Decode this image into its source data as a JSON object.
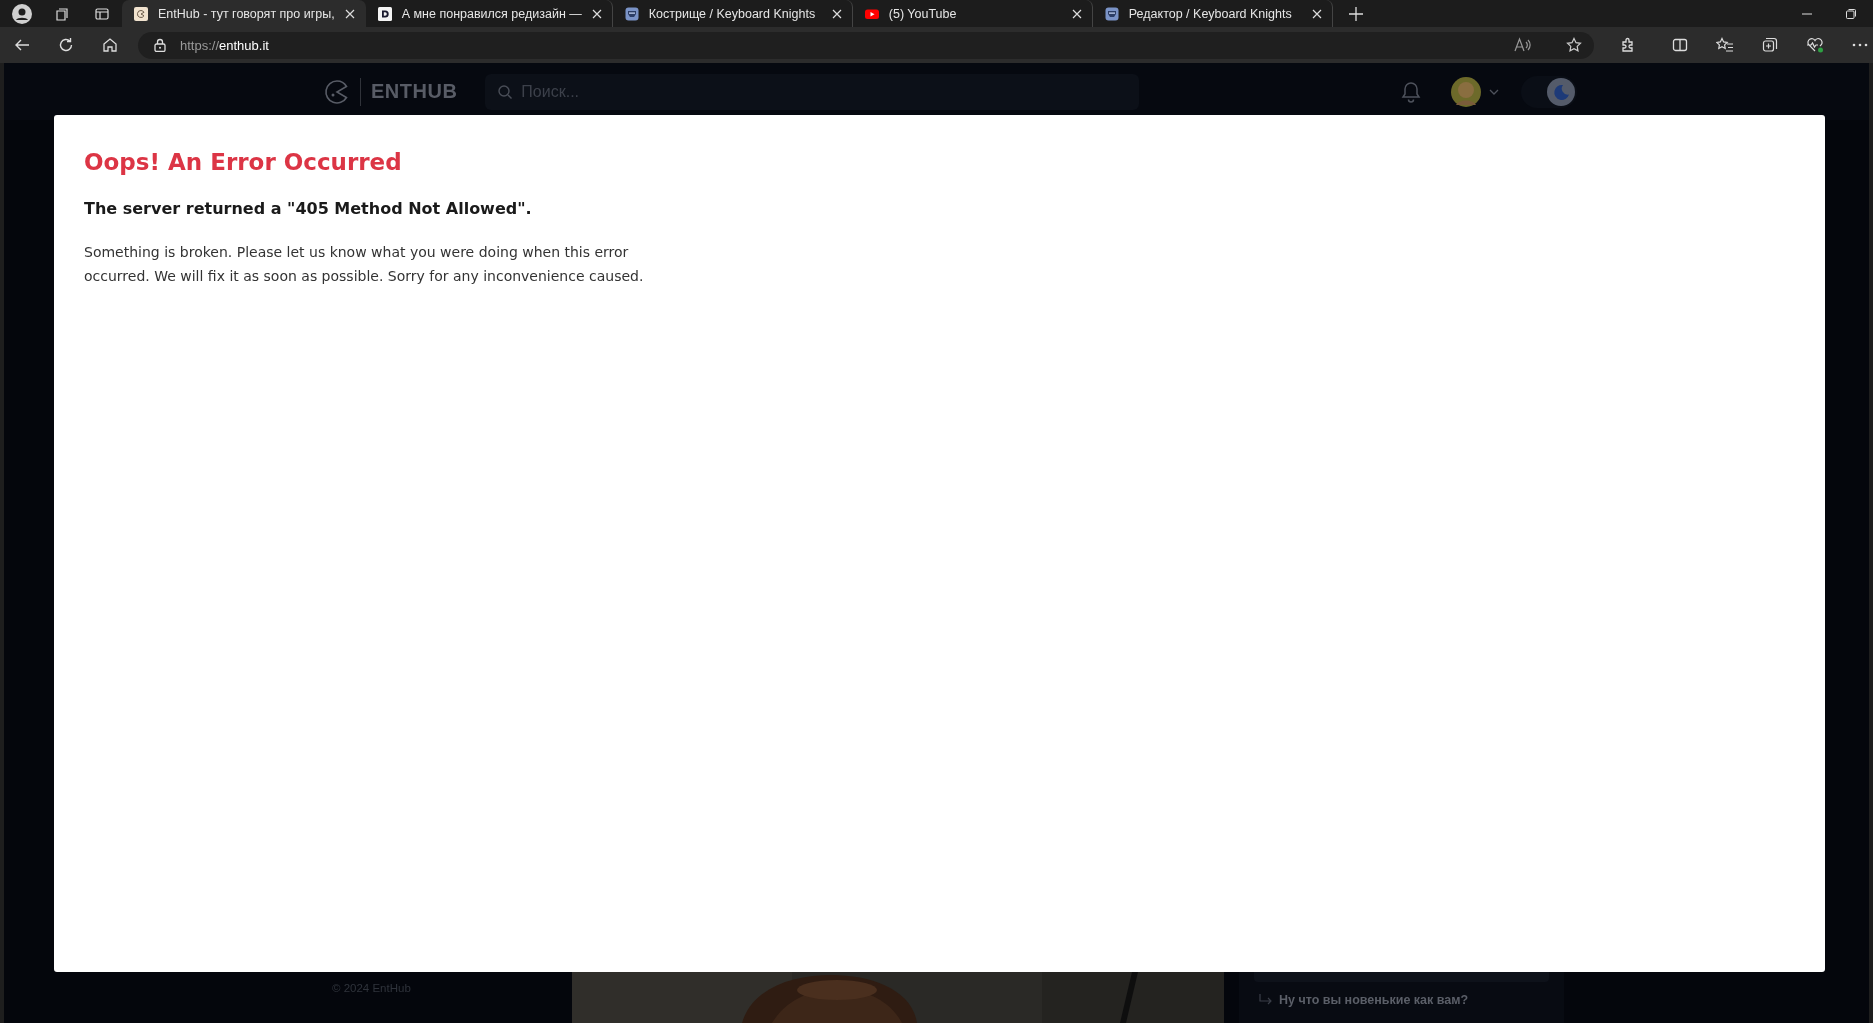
{
  "browser": {
    "tabs": [
      {
        "title": "EntHub - тут говорят про игры,",
        "selected": true,
        "kind": "enthub"
      },
      {
        "title": "А мне понравился редизайн —",
        "selected": false,
        "kind": "letter"
      },
      {
        "title": "Кострище / Keyboard Knights",
        "selected": false,
        "kind": "knight"
      },
      {
        "title": "(5) YouTube",
        "selected": false,
        "kind": "video"
      },
      {
        "title": "Редактор / Keyboard Knights",
        "selected": false,
        "kind": "knight"
      }
    ],
    "address": {
      "scheme": "https://",
      "host": "enthub.it"
    }
  },
  "site": {
    "logo": "ENTHUB",
    "dark_mode": {
      "on": true
    },
    "search": {
      "placeholder": "Поиск..."
    },
    "footer": "© 2024 EntHub",
    "comment_reply": "Ну что вы новенькие как вам?"
  },
  "error": {
    "title": "Oops! An Error Occurred",
    "subtitle": "The server returned a \"405 Method Not Allowed\".",
    "message": "Something is broken. Please let us know what you were doing when this error occurred. We will fix it as soon as possible. Sorry for any inconvenience caused."
  }
}
